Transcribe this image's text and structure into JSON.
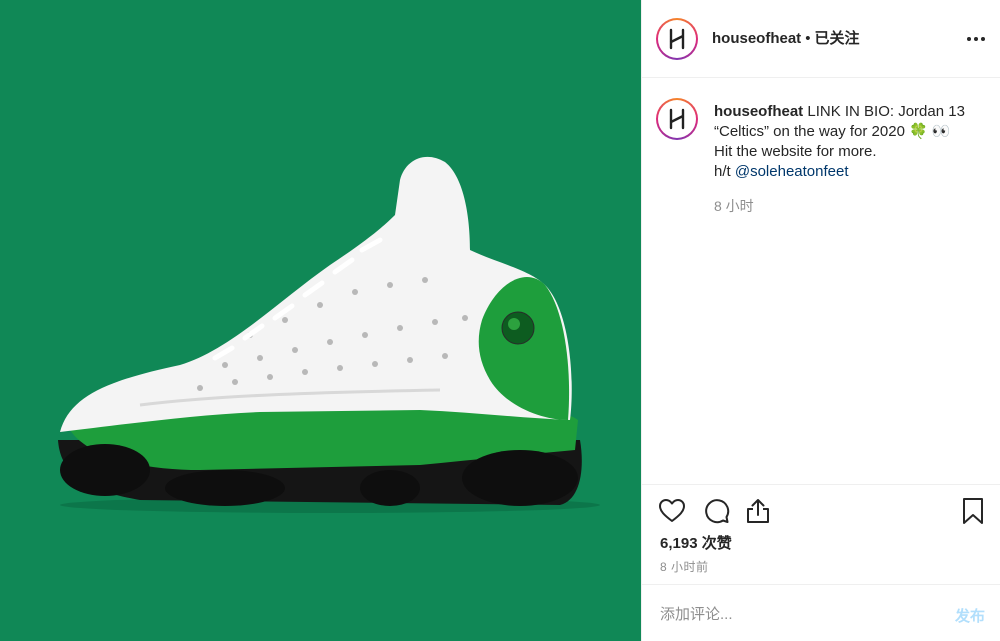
{
  "post_media": {
    "background": "#108856",
    "subject": "sneaker-image"
  },
  "header": {
    "username": "houseofheat",
    "separator": "•",
    "follow_label": "已关注"
  },
  "caption": {
    "username": "houseofheat",
    "line1": "LINK IN BIO: Jordan 13",
    "line2": "“Celtics” on the way for 2020 🍀 👀",
    "line3": "Hit the website for more.",
    "line4_prefix": "h/t ",
    "mention": "@soleheatonfeet",
    "time_ago": "8 小时"
  },
  "actions": {
    "likes": "6,193 次赞",
    "timestamp": "8 小时前"
  },
  "comment": {
    "placeholder": "添加评论...",
    "post_label": "发布"
  },
  "colors": {
    "mention": "#00376b",
    "muted": "#8e8e8e",
    "post_disabled": "#b2dffc"
  }
}
